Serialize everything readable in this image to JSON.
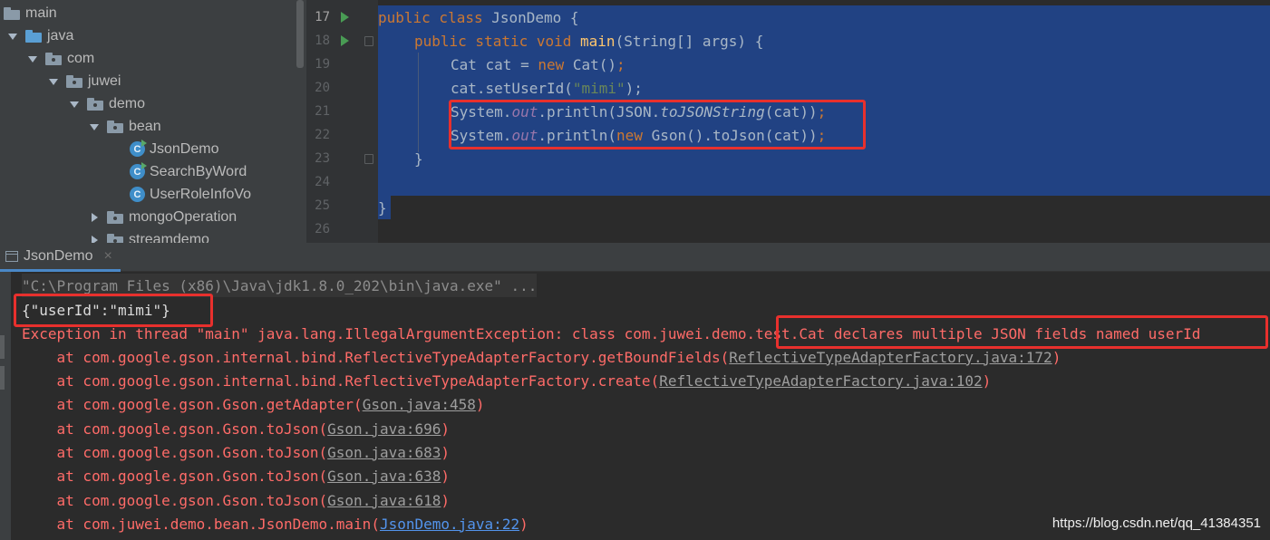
{
  "project_tree": {
    "items": [
      {
        "label": "main",
        "icon": "folder-icon"
      },
      {
        "label": "java",
        "icon": "source-folder-icon"
      },
      {
        "label": "com",
        "icon": "package-icon"
      },
      {
        "label": "juwei",
        "icon": "package-icon"
      },
      {
        "label": "demo",
        "icon": "package-icon"
      },
      {
        "label": "bean",
        "icon": "package-icon"
      },
      {
        "label": "JsonDemo",
        "icon": "class-icon"
      },
      {
        "label": "SearchByWord",
        "icon": "class-icon"
      },
      {
        "label": "UserRoleInfoVo",
        "icon": "class-icon"
      },
      {
        "label": "mongoOperation",
        "icon": "package-icon"
      },
      {
        "label": "streamdemo",
        "icon": "package-icon"
      }
    ]
  },
  "editor": {
    "line_numbers": [
      "17",
      "18",
      "19",
      "20",
      "21",
      "22",
      "23",
      "24",
      "25",
      "26"
    ],
    "lines": {
      "l17": {
        "kw": "public class ",
        "name": "JsonDemo",
        "rest": " {"
      },
      "l18": {
        "kw": "public static void ",
        "fn": "main",
        "rest": "(String[] args) {"
      },
      "l19": {
        "a": "Cat cat = ",
        "kw": "new ",
        "b": "Cat()",
        "c": ";"
      },
      "l20": {
        "a": "cat.setUserId(",
        "str": "\"mimi\"",
        "b": ");"
      },
      "l21": {
        "a": "System.",
        "fld": "out",
        "b": ".println(JSON.",
        "it": "toJSONString",
        "c": "(cat))",
        "d": ";"
      },
      "l22": {
        "a": "System.",
        "fld": "out",
        "b": ".println(",
        "kw": "new ",
        "c": "Gson().toJson(cat))",
        "d": ";"
      },
      "l23": {
        "a": "}"
      },
      "l25": {
        "a": "}"
      }
    }
  },
  "run_panel": {
    "tab_label": "JsonDemo",
    "close_glyph": "×",
    "console": {
      "command": "\"C:\\Program Files (x86)\\Java\\jdk1.8.0_202\\bin\\java.exe\" ...",
      "output": "{\"userId\":\"mimi\"}",
      "exception": "Exception in thread \"main\" java.lang.IllegalArgumentException: class com.juwei.demo.test.Cat declares multiple JSON fields named userId",
      "stack": [
        {
          "text": "    at com.google.gson.internal.bind.ReflectiveTypeAdapterFactory.getBoundFields(",
          "link": "ReflectiveTypeAdapterFactory.java:172",
          "close": ")"
        },
        {
          "text": "    at com.google.gson.internal.bind.ReflectiveTypeAdapterFactory.create(",
          "link": "ReflectiveTypeAdapterFactory.java:102",
          "close": ")"
        },
        {
          "text": "    at com.google.gson.Gson.getAdapter(",
          "link": "Gson.java:458",
          "close": ")"
        },
        {
          "text": "    at com.google.gson.Gson.toJson(",
          "link": "Gson.java:696",
          "close": ")"
        },
        {
          "text": "    at com.google.gson.Gson.toJson(",
          "link": "Gson.java:683",
          "close": ")"
        },
        {
          "text": "    at com.google.gson.Gson.toJson(",
          "link": "Gson.java:638",
          "close": ")"
        },
        {
          "text": "    at com.google.gson.Gson.toJson(",
          "link": "Gson.java:618",
          "close": ")"
        },
        {
          "text": "    at com.juwei.demo.bean.JsonDemo.main(",
          "link": "JsonDemo.java:22",
          "close": ")"
        }
      ]
    }
  },
  "watermark": "https://blog.csdn.net/qq_41384351",
  "colors": {
    "keyword": "#cc7832",
    "method": "#ffc66d",
    "string": "#6a8759",
    "static_field": "#9876aa",
    "error": "#ff6b68",
    "selection": "#214283",
    "highlight_box": "#e8302d"
  }
}
